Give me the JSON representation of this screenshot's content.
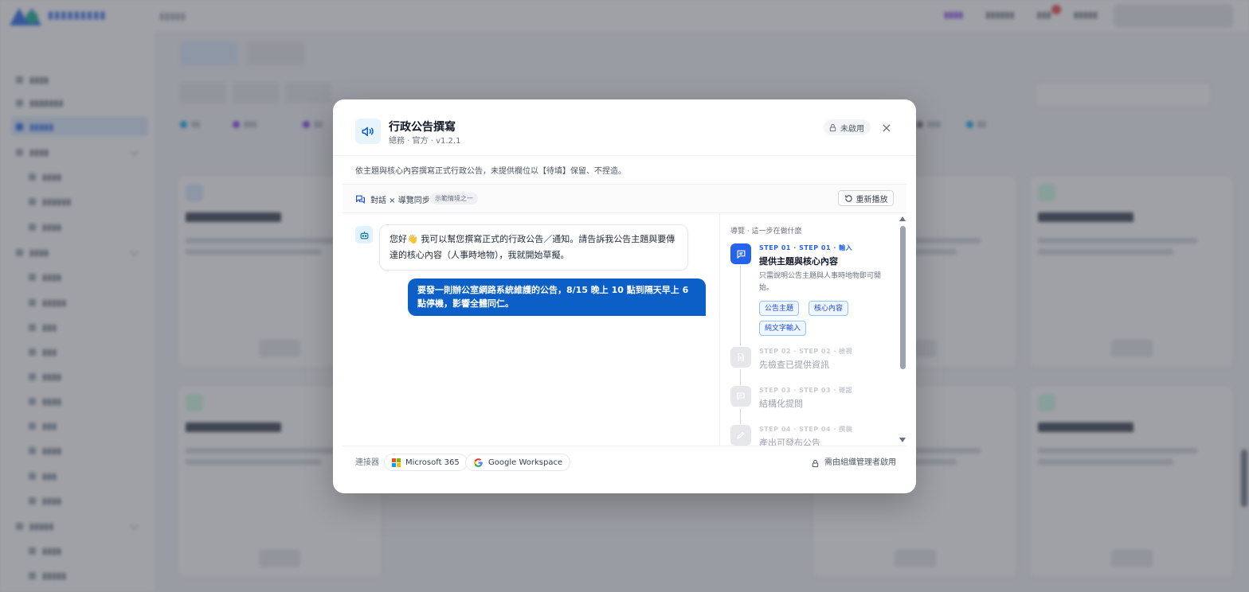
{
  "modal": {
    "title": "行政公告撰寫",
    "meta": "總務 · 官方 · v1.2.1",
    "status_badge": "未啟用",
    "close_glyph": "×",
    "description": "依主題與核心內容撰寫正式行政公告，未提供欄位以【待填】保留、不捏造。",
    "demo": {
      "label": "對話 × 導覽同步",
      "tag": "示範情境之一",
      "replay_label": "重新播放"
    },
    "chat": {
      "bot_message": "您好👋 我可以幫您撰寫正式的行政公告／通知。請告訴我公告主題與要傳達的核心內容（人事時地物），我就開始草擬。",
      "user_message": "要發一則辦公室網路系統維護的公告，8/15 晚上 10 點到隔天早上 6 點停機，影響全體同仁。"
    },
    "guide": {
      "heading": "導覽 · 這一步在做什麼",
      "steps": [
        {
          "label": "STEP 01 · STEP 01 · 輸入",
          "title": "提供主題與核心內容",
          "desc": "只需說明公告主題與人事時地物即可開始。",
          "tags": [
            "公告主題",
            "核心內容",
            "純文字輸入"
          ]
        },
        {
          "label": "STEP 02 · STEP 02 · 檢視",
          "title": "先檢查已提供資訊"
        },
        {
          "label": "STEP 03 · STEP 03 · 確認",
          "title": "結構化提問"
        },
        {
          "label": "STEP 04 · STEP 04 · 撰稿",
          "title": "產出可發布公告"
        }
      ]
    },
    "footer": {
      "label": "連接器",
      "connectors": [
        "Microsoft 365",
        "Google Workspace"
      ],
      "note": "需由組織管理者啟用"
    }
  },
  "colors": {
    "accent": "#2563eb",
    "user_bubble": "#0b5fc7",
    "overlay": "#464b55",
    "step_active": "#2563eb",
    "step_inactive": "#d1d5db"
  },
  "icons": {
    "modal": "megaphone-icon",
    "status": "lock-icon",
    "close": "close-icon",
    "demo": "chat-bubbles-icon",
    "replay": "replay-icon",
    "bot": "robot-icon",
    "step_1": "message-square-icon",
    "step_2": "document-icon",
    "step_3": "message-square-icon",
    "step_4": "pencil-icon",
    "footer_note": "lock-icon"
  }
}
